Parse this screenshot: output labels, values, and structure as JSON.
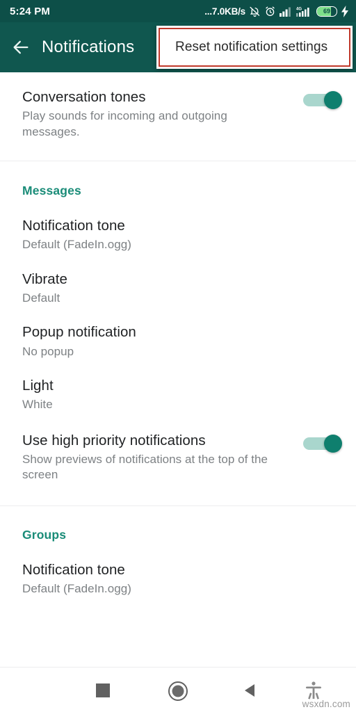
{
  "status_bar": {
    "clock": "5:24 PM",
    "network_speed": "...7.0KB/s",
    "icons": [
      "bell-muted-icon",
      "alarm-clock-icon",
      "signal-bars-icon",
      "signal-4g-icon",
      "battery-icon",
      "charging-bolt-icon"
    ],
    "battery_percent": "69",
    "background_color": "#0d4f48"
  },
  "app_bar": {
    "back_icon": "arrow-left-icon",
    "title": "Notifications",
    "background_color": "#10574f"
  },
  "overflow_menu": {
    "items": [
      "Reset notification settings"
    ],
    "highlight_color": "#c0392b"
  },
  "content": {
    "top_rows": [
      {
        "title": "Conversation tones",
        "subtitle": "Play sounds for incoming and outgoing messages.",
        "toggle": "on"
      }
    ],
    "sections": [
      {
        "heading": "Messages",
        "heading_color": "#1a8c78",
        "rows": [
          {
            "title": "Notification tone",
            "subtitle": "Default (FadeIn.ogg)"
          },
          {
            "title": "Vibrate",
            "subtitle": "Default"
          },
          {
            "title": "Popup notification",
            "subtitle": "No popup"
          },
          {
            "title": "Light",
            "subtitle": "White"
          },
          {
            "title": "Use high priority notifications",
            "subtitle": "Show previews of notifications at the top of the screen",
            "toggle": "on"
          }
        ]
      },
      {
        "heading": "Groups",
        "heading_color": "#1a8c78",
        "rows": [
          {
            "title": "Notification tone",
            "subtitle": "Default (FadeIn.ogg)"
          }
        ]
      }
    ]
  },
  "nav_bar": {
    "buttons": [
      {
        "name": "recents-button",
        "icon": "square-icon"
      },
      {
        "name": "home-button",
        "icon": "circle-icon"
      },
      {
        "name": "back-button",
        "icon": "triangle-left-icon"
      },
      {
        "name": "accessibility-button",
        "icon": "accessibility-icon"
      }
    ]
  },
  "watermark": "wsxdn.com"
}
